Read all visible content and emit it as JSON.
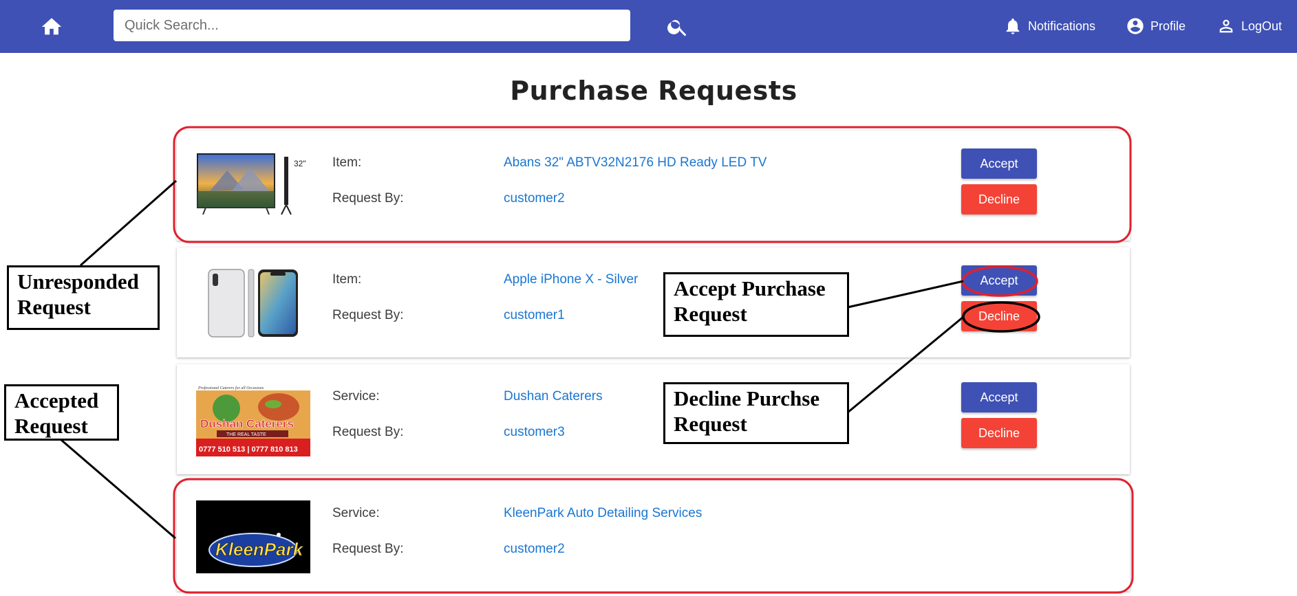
{
  "navbar": {
    "search_placeholder": "Quick Search...",
    "notifications_label": "Notifications",
    "profile_label": "Profile",
    "logout_label": "LogOut",
    "bg_color": "#3f51b5"
  },
  "page": {
    "title": "Purchase Requests"
  },
  "requests": [
    {
      "type_label": "Item:",
      "name": "Abans 32\" ABTV32N2176 HD Ready LED TV",
      "request_by_label": "Request By:",
      "requester": "customer2",
      "accept_label": "Accept",
      "decline_label": "Decline",
      "thumb": "tv-image"
    },
    {
      "type_label": "Item:",
      "name": "Apple iPhone X - Silver",
      "request_by_label": "Request By:",
      "requester": "customer1",
      "accept_label": "Accept",
      "decline_label": "Decline",
      "thumb": "phone-image"
    },
    {
      "type_label": "Service:",
      "name": "Dushan Caterers",
      "request_by_label": "Request By:",
      "requester": "customer3",
      "accept_label": "Accept",
      "decline_label": "Decline",
      "thumb": "caterer-logo"
    },
    {
      "type_label": "Service:",
      "name": "KleenPark Auto Detailing Services",
      "request_by_label": "Request By:",
      "requester": "customer2",
      "thumb": "kleenpark-logo"
    }
  ],
  "thumb_text": {
    "tv_badge": "32\"",
    "caterer_tagline": "Professional Caterers for all Occasions",
    "caterer_name": "Dushan Caterers",
    "caterer_slogan": "THE REAL TASTE",
    "caterer_phone": "0777 510 513 | 0777 810 813",
    "kleenpark_name": "KleenPark"
  },
  "annotations": {
    "unresponded": "Unresponded Request",
    "accepted": "Accepted Request",
    "accept_purchase": "Accept Purchase Request",
    "decline_purchase": "Decline Purchse Request"
  },
  "colors": {
    "primary": "#3f51b5",
    "danger": "#f44336",
    "link": "#1976d2",
    "highlight": "#e0202e"
  }
}
